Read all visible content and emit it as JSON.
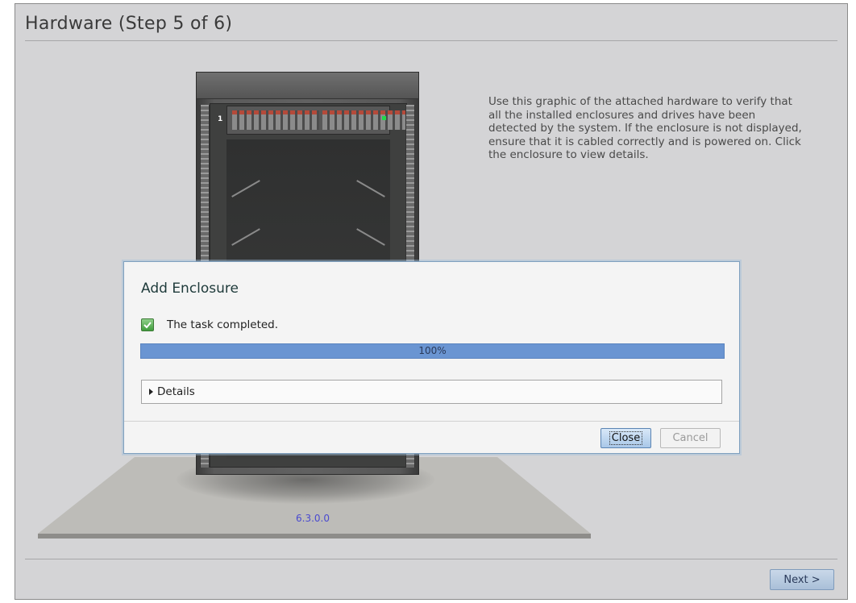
{
  "page": {
    "title": "Hardware (Step 5 of 6)",
    "description": "Use this graphic of the attached hardware to verify that all the installed enclosures and drives have been detected by the system. If the enclosure is not displayed, ensure that it is cabled correctly and is powered on. Click the enclosure to view details.",
    "version": "6.3.0.0",
    "next_label": "Next >"
  },
  "rack": {
    "enclosure_number": "1",
    "status_led_color": "#22d84a"
  },
  "dialog": {
    "title": "Add Enclosure",
    "status_icon": "check-icon",
    "status_text": "The task completed.",
    "progress_percent": 100,
    "progress_label": "100%",
    "details_label": "Details",
    "close_label": "Close",
    "cancel_label": "Cancel"
  },
  "colors": {
    "progress": "#6a95d2",
    "accent_button": "#a9c7e8"
  }
}
